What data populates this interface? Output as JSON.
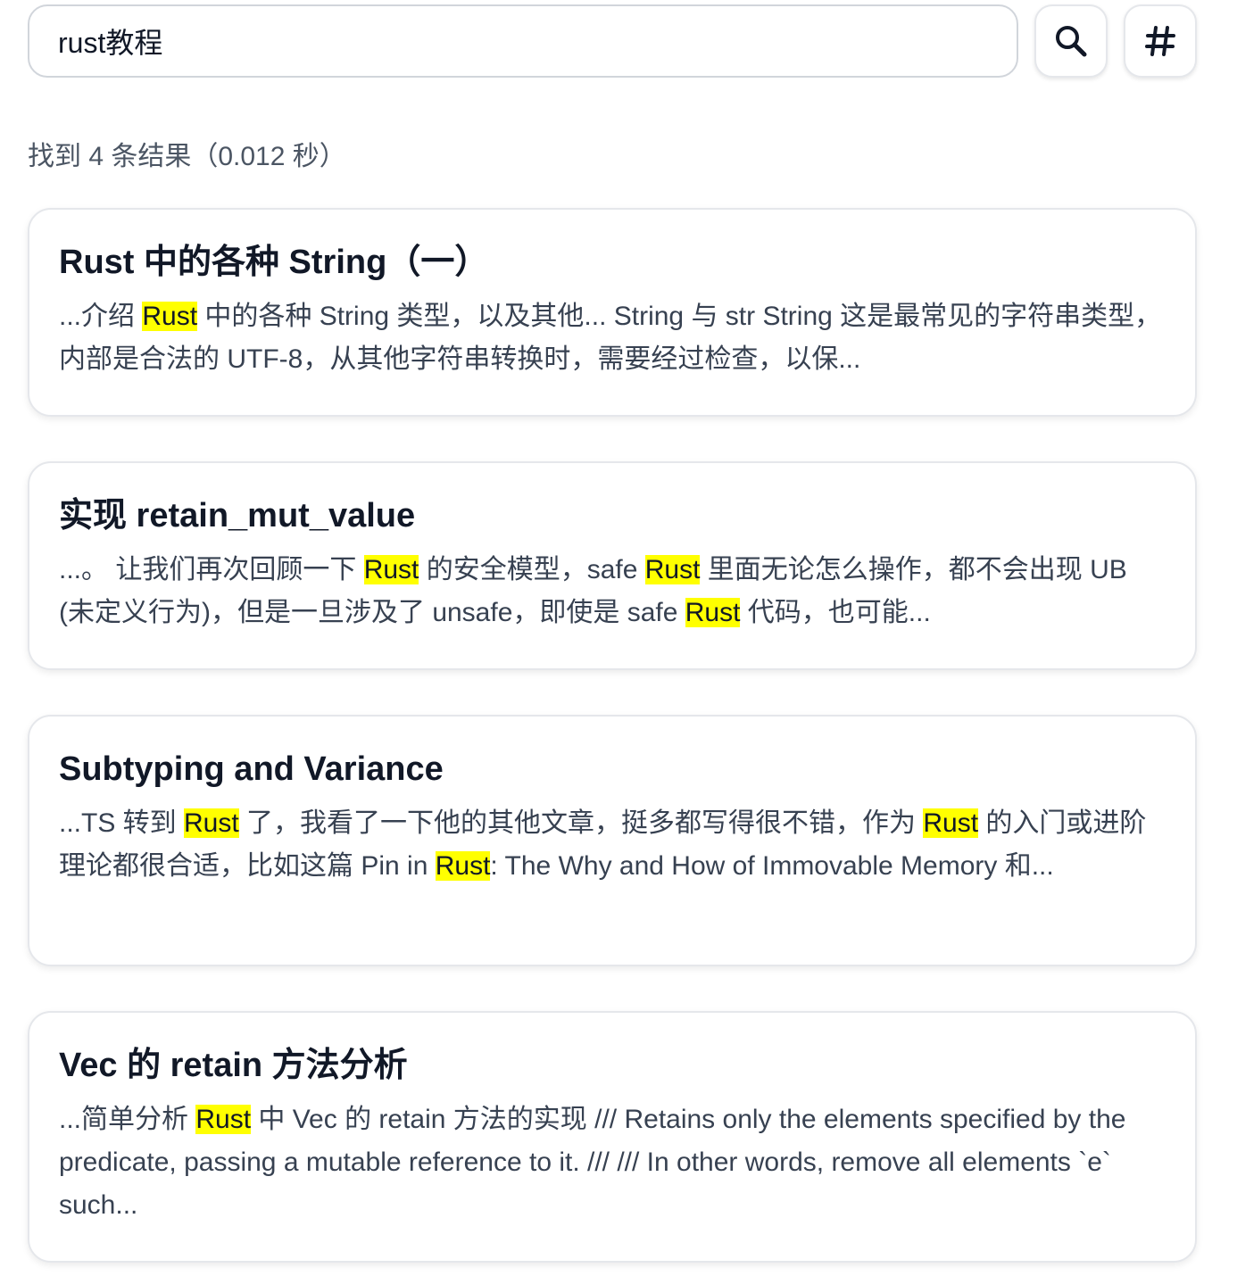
{
  "search": {
    "query": "rust教程",
    "search_button_icon": "search-icon",
    "tag_button_icon": "hash-icon"
  },
  "summary": "找到 4 条结果（0.012 秒）",
  "highlight_color": "#ffff00",
  "results": [
    {
      "title": "Rust 中的各种 String（一）",
      "snippet": [
        {
          "t": "...介绍 "
        },
        {
          "t": "Rust",
          "hl": true
        },
        {
          "t": " 中的各种 String 类型，以及其他... String 与 str String 这是最常见的字符串类型，内部是合法的 UTF-8，从其他字符串转换时，需要经过检查，以保..."
        }
      ]
    },
    {
      "title": "实现 retain_mut_value",
      "snippet": [
        {
          "t": "...。 让我们再次回顾一下 "
        },
        {
          "t": "Rust",
          "hl": true
        },
        {
          "t": " 的安全模型，safe "
        },
        {
          "t": "Rust",
          "hl": true
        },
        {
          "t": " 里面无论怎么操作，都不会出现 UB (未定义行为)，但是一旦涉及了 unsafe，即使是 safe "
        },
        {
          "t": "Rust",
          "hl": true
        },
        {
          "t": " 代码，也可能..."
        }
      ]
    },
    {
      "title": "Subtyping and Variance",
      "snippet": [
        {
          "t": "...TS 转到 "
        },
        {
          "t": "Rust",
          "hl": true
        },
        {
          "t": " 了，我看了一下他的其他文章，挺多都写得很不错，作为 "
        },
        {
          "t": "Rust",
          "hl": true
        },
        {
          "t": " 的入门或进阶理论都很合适，比如这篇 Pin in "
        },
        {
          "t": "Rust",
          "hl": true
        },
        {
          "t": ": The Why and How of Immovable Memory 和..."
        }
      ]
    },
    {
      "title": "Vec 的 retain 方法分析",
      "snippet": [
        {
          "t": "...简单分析 "
        },
        {
          "t": "Rust",
          "hl": true
        },
        {
          "t": " 中 Vec 的 retain 方法的实现 /// Retains only the elements specified by the predicate, passing a mutable reference to it. /// /// In other words, remove all elements `e` such..."
        }
      ]
    }
  ]
}
